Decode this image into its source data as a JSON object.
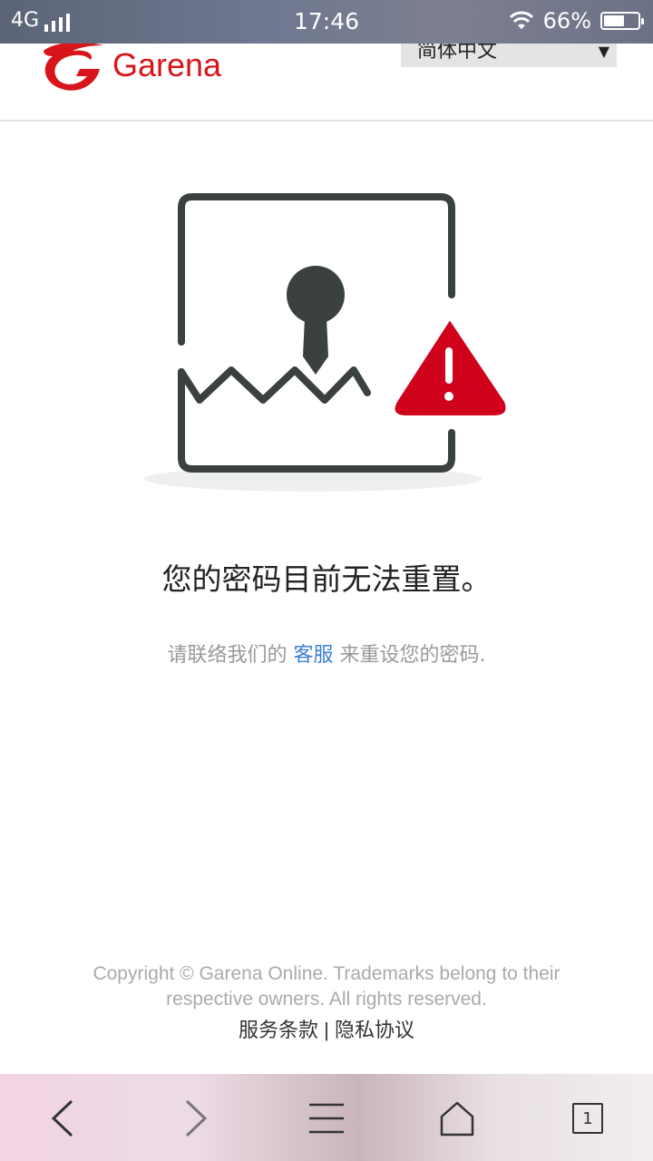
{
  "status_bar": {
    "network": "4G",
    "time": "17:46",
    "battery": "66%",
    "battery_level": 0.66
  },
  "header": {
    "brand": "Garena",
    "language": "简体中文"
  },
  "main": {
    "headline": "您的密码目前无法重置。",
    "sub_prefix": "请联络我们的",
    "sub_link": "客服",
    "sub_suffix": "来重设您的密码."
  },
  "footer": {
    "copyright": "Copyright © Garena Online. Trademarks belong to their respective owners. All rights reserved.",
    "terms": "服务条款",
    "separator": "|",
    "privacy": "隐私协议"
  },
  "toolbar": {
    "tab_count": "1"
  },
  "colors": {
    "brand_red": "#d7151a",
    "link_blue": "#3d7ed6",
    "icon_dark": "#3b4040",
    "warning_red": "#d0021b"
  }
}
